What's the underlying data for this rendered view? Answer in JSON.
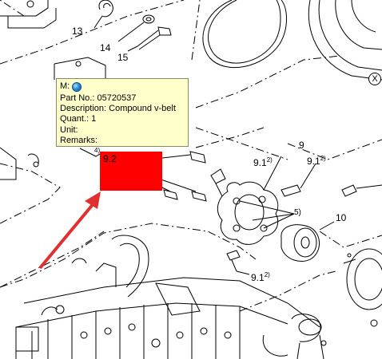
{
  "tooltip": {
    "m_label": "M:",
    "part_no": "Part No.: 05720537",
    "description": "Description: Compound v-belt",
    "quant": "Quant.: 1",
    "unit": "Unit:",
    "remarks": "Remarks:"
  },
  "hotspot": {
    "label": "9.2",
    "color": "#ff0000"
  },
  "callouts": {
    "c13": "13",
    "c14": "14",
    "c15": "15",
    "c4": "4)",
    "c9": "9",
    "c9_1_a": "9.1",
    "c9_1_a_sup": "2)",
    "c9_1_b": "9.1",
    "c9_1_b_sup": "2)",
    "c9_1_c": "9.1",
    "c9_1_c_sup": "2)",
    "c5": "5)",
    "c10": "10",
    "close_glyph": "X"
  },
  "colors": {
    "tooltip_bg": "#ffffcc",
    "arrow": "#e03030",
    "hotspot": "#ff0000"
  },
  "icons": {
    "globe": "globe-icon",
    "close": "close-icon"
  }
}
